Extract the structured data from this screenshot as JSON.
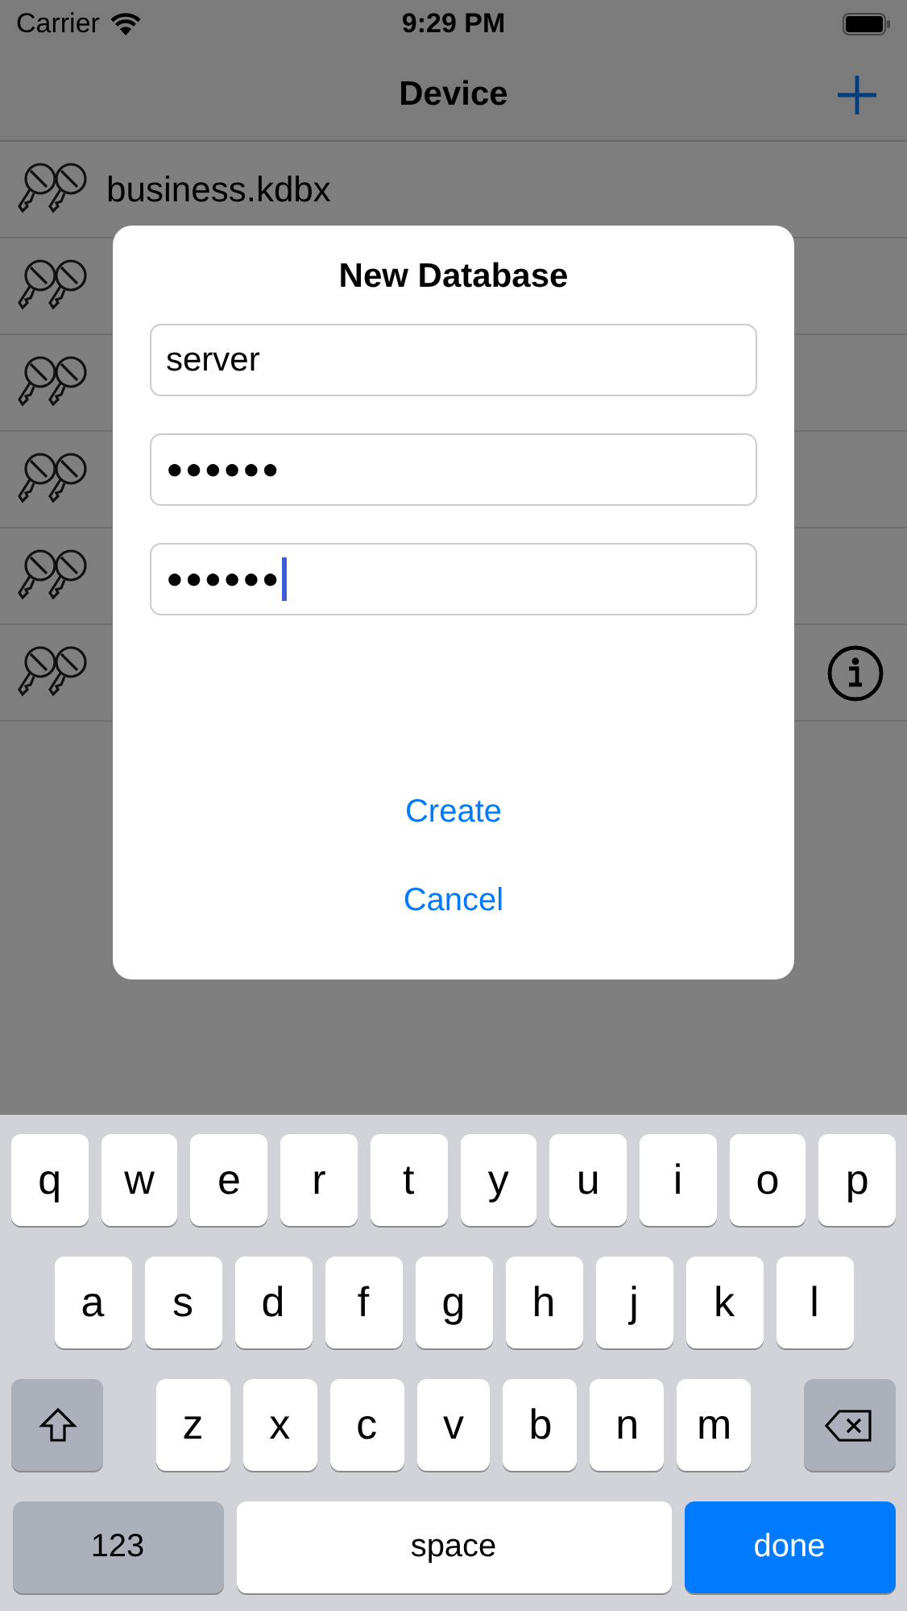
{
  "status_bar": {
    "carrier": "Carrier",
    "time": "9:29 PM"
  },
  "nav": {
    "title": "Device"
  },
  "files": [
    {
      "name": "business.kdbx",
      "info": false
    },
    {
      "info": false
    },
    {
      "info": false
    },
    {
      "info": false
    },
    {
      "info": false
    },
    {
      "info": true
    }
  ],
  "dialog": {
    "title": "New Database",
    "fields": [
      {
        "kind": "text",
        "value": "server",
        "focused": false
      },
      {
        "kind": "password",
        "value": "●●●●●●",
        "focused": false
      },
      {
        "kind": "password",
        "value": "●●●●●●",
        "focused": true
      }
    ],
    "actions": [
      "Create",
      "Cancel"
    ]
  },
  "keyboard": {
    "rows": [
      [
        "q",
        "w",
        "e",
        "r",
        "t",
        "y",
        "u",
        "i",
        "o",
        "p"
      ],
      [
        "a",
        "s",
        "d",
        "f",
        "g",
        "h",
        "j",
        "k",
        "l"
      ],
      [
        "z",
        "x",
        "c",
        "v",
        "b",
        "n",
        "m"
      ]
    ],
    "bottom": [
      {
        "kind": "mode",
        "label": "123"
      },
      {
        "kind": "space",
        "label": "space"
      },
      {
        "kind": "done",
        "label": "done"
      }
    ]
  }
}
